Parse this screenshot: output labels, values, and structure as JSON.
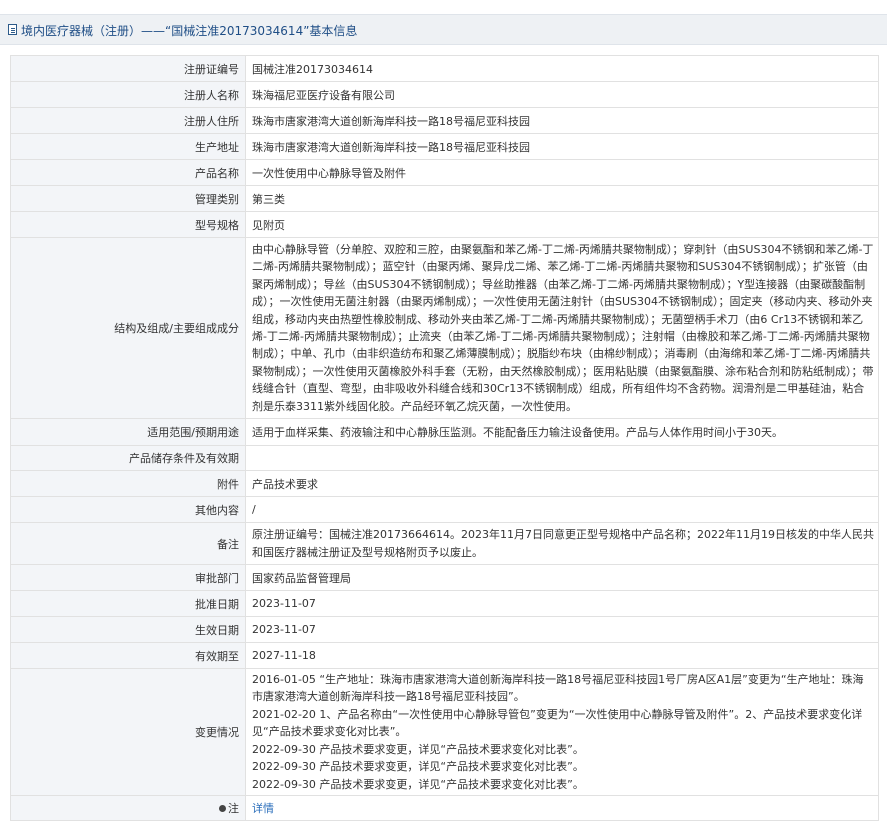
{
  "header": {
    "title": "境内医疗器械（注册）——“国械注准20173034614”基本信息"
  },
  "rows": [
    {
      "label": "注册证编号",
      "value": "国械注准20173034614"
    },
    {
      "label": "注册人名称",
      "value": "珠海福尼亚医疗设备有限公司"
    },
    {
      "label": "注册人住所",
      "value": "珠海市唐家港湾大道创新海岸科技一路18号福尼亚科技园"
    },
    {
      "label": "生产地址",
      "value": "珠海市唐家港湾大道创新海岸科技一路18号福尼亚科技园"
    },
    {
      "label": "产品名称",
      "value": "一次性使用中心静脉导管及附件"
    },
    {
      "label": "管理类别",
      "value": "第三类"
    },
    {
      "label": "型号规格",
      "value": "见附页"
    },
    {
      "label": "结构及组成/主要组成成分",
      "value": "由中心静脉导管（分单腔、双腔和三腔，由聚氨酯和苯乙烯-丁二烯-丙烯腈共聚物制成）；穿刺针（由SUS304不锈钢和苯乙烯-丁二烯-丙烯腈共聚物制成）；蓝空针（由聚丙烯、聚异戊二烯、苯乙烯-丁二烯-丙烯腈共聚物和SUS304不锈钢制成）；扩张管（由聚丙烯制成）；导丝（由SUS304不锈钢制成）；导丝助推器（由苯乙烯-丁二烯-丙烯腈共聚物制成）；Y型连接器（由聚碳酸酯制成）；一次性使用无菌注射器（由聚丙烯制成）；一次性使用无菌注射针（由SUS304不锈钢制成）；固定夹（移动内夹、移动外夹组成，移动内夹由热塑性橡胶制成、移动外夹由苯乙烯-丁二烯-丙烯腈共聚物制成）；无菌塑柄手术刀（由6 Cr13不锈钢和苯乙烯-丁二烯-丙烯腈共聚物制成）；止流夹（由苯乙烯-丁二烯-丙烯腈共聚物制成）；注射帽（由橡胶和苯乙烯-丁二烯-丙烯腈共聚物制成）；中单、孔巾（由非织造纺布和聚乙烯薄膜制成）；脱脂纱布块（由棉纱制成）；消毒刷（由海绵和苯乙烯-丁二烯-丙烯腈共聚物制成）；一次性使用灭菌橡胶外科手套（无粉，由天然橡胶制成）；医用粘贴膜（由聚氨酯膜、涂布粘合剂和防粘纸制成）；带线缝合针（直型、弯型，由非吸收外科缝合线和30Cr13不锈钢制成）组成，所有组件均不含药物。润滑剂是二甲基硅油，粘合剂是乐泰3311紫外线固化胶。产品经环氧乙烷灭菌，一次性使用。"
    },
    {
      "label": "适用范围/预期用途",
      "value": "适用于血样采集、药液输注和中心静脉压监测。不能配备压力输注设备使用。产品与人体作用时间小于30天。"
    },
    {
      "label": "产品储存条件及有效期",
      "value": ""
    },
    {
      "label": "附件",
      "value": "产品技术要求"
    },
    {
      "label": "其他内容",
      "value": "/"
    },
    {
      "label": "备注",
      "value": "原注册证编号：国械注准20173664614。2023年11月7日同意更正型号规格中产品名称；2022年11月19日核发的中华人民共和国医疗器械注册证及型号规格附页予以废止。"
    },
    {
      "label": "审批部门",
      "value": "国家药品监督管理局"
    },
    {
      "label": "批准日期",
      "value": "2023-11-07"
    },
    {
      "label": "生效日期",
      "value": "2023-11-07"
    },
    {
      "label": "有效期至",
      "value": "2027-11-18"
    }
  ],
  "changes": {
    "label": "变更情况",
    "entries": [
      "2016-01-05 “生产地址：珠海市唐家港湾大道创新海岸科技一路18号福尼亚科技园1号厂房A区A1层”变更为“生产地址：珠海市唐家港湾大道创新海岸科技一路18号福尼亚科技园”。",
      "2021-02-20 1、产品名称由“一次性使用中心静脉导管包”变更为“一次性使用中心静脉导管及附件”。2、产品技术要求变化详见“产品技术要求变化对比表”。",
      "2022-09-30 产品技术要求变更，详见“产品技术要求变化对比表”。",
      "2022-09-30 产品技术要求变更，详见“产品技术要求变化对比表”。",
      "2022-09-30 产品技术要求变更，详见“产品技术要求变化对比表”。"
    ]
  },
  "note": {
    "label": "注",
    "link": "详情"
  }
}
